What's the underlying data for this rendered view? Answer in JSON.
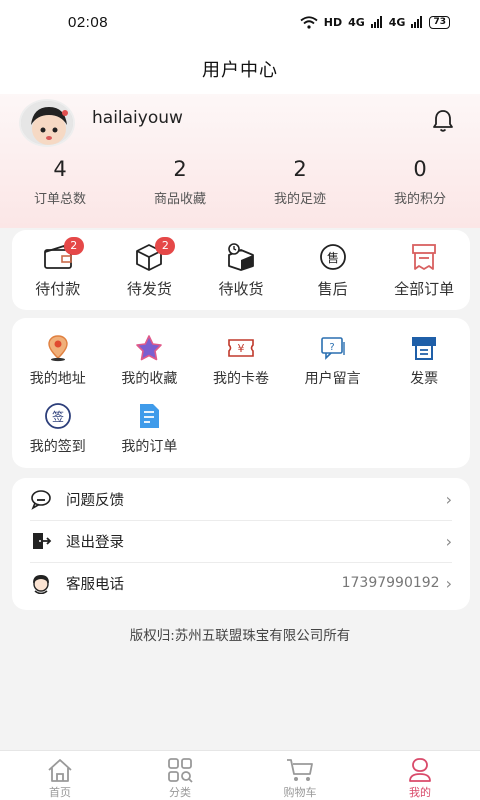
{
  "status": {
    "time": "02:08",
    "network": "HD",
    "signal1": "4G",
    "signal2": "4G",
    "battery": "73"
  },
  "header": {
    "title": "用户中心"
  },
  "profile": {
    "username": "hailaiyouw",
    "stats": [
      {
        "value": "4",
        "label": "订单总数"
      },
      {
        "value": "2",
        "label": "商品收藏"
      },
      {
        "value": "2",
        "label": "我的足迹"
      },
      {
        "value": "0",
        "label": "我的积分"
      }
    ]
  },
  "orders": [
    {
      "label": "待付款",
      "badge": "2",
      "icon": "wallet-icon"
    },
    {
      "label": "待发货",
      "badge": "2",
      "icon": "box-icon"
    },
    {
      "label": "待收货",
      "badge": "",
      "icon": "delivery-box-icon"
    },
    {
      "label": "售后",
      "badge": "",
      "icon": "after-sale-icon"
    },
    {
      "label": "全部订单",
      "badge": "",
      "icon": "receipt-icon"
    }
  ],
  "tools": [
    {
      "label": "我的地址",
      "icon": "location-pin-icon"
    },
    {
      "label": "我的收藏",
      "icon": "star-icon"
    },
    {
      "label": "我的卡卷",
      "icon": "coupon-icon"
    },
    {
      "label": "用户留言",
      "icon": "message-icon"
    },
    {
      "label": "发票",
      "icon": "invoice-icon"
    },
    {
      "label": "我的签到",
      "icon": "sign-in-icon"
    },
    {
      "label": "我的订单",
      "icon": "document-icon"
    }
  ],
  "menu": [
    {
      "label": "问题反馈",
      "value": "",
      "icon": "feedback-icon"
    },
    {
      "label": "退出登录",
      "value": "",
      "icon": "logout-icon"
    },
    {
      "label": "客服电话",
      "value": "17397990192",
      "icon": "customer-service-icon"
    }
  ],
  "copyright": "版权归:苏州五联盟珠宝有限公司所有",
  "tabs": [
    {
      "label": "首页",
      "icon": "home-icon"
    },
    {
      "label": "分类",
      "icon": "category-icon"
    },
    {
      "label": "购物车",
      "icon": "cart-icon"
    },
    {
      "label": "我的",
      "icon": "user-icon"
    }
  ],
  "colors": {
    "accent": "#d94a6a",
    "badge": "#e54848",
    "profile_bg": "#fbe6e6"
  }
}
